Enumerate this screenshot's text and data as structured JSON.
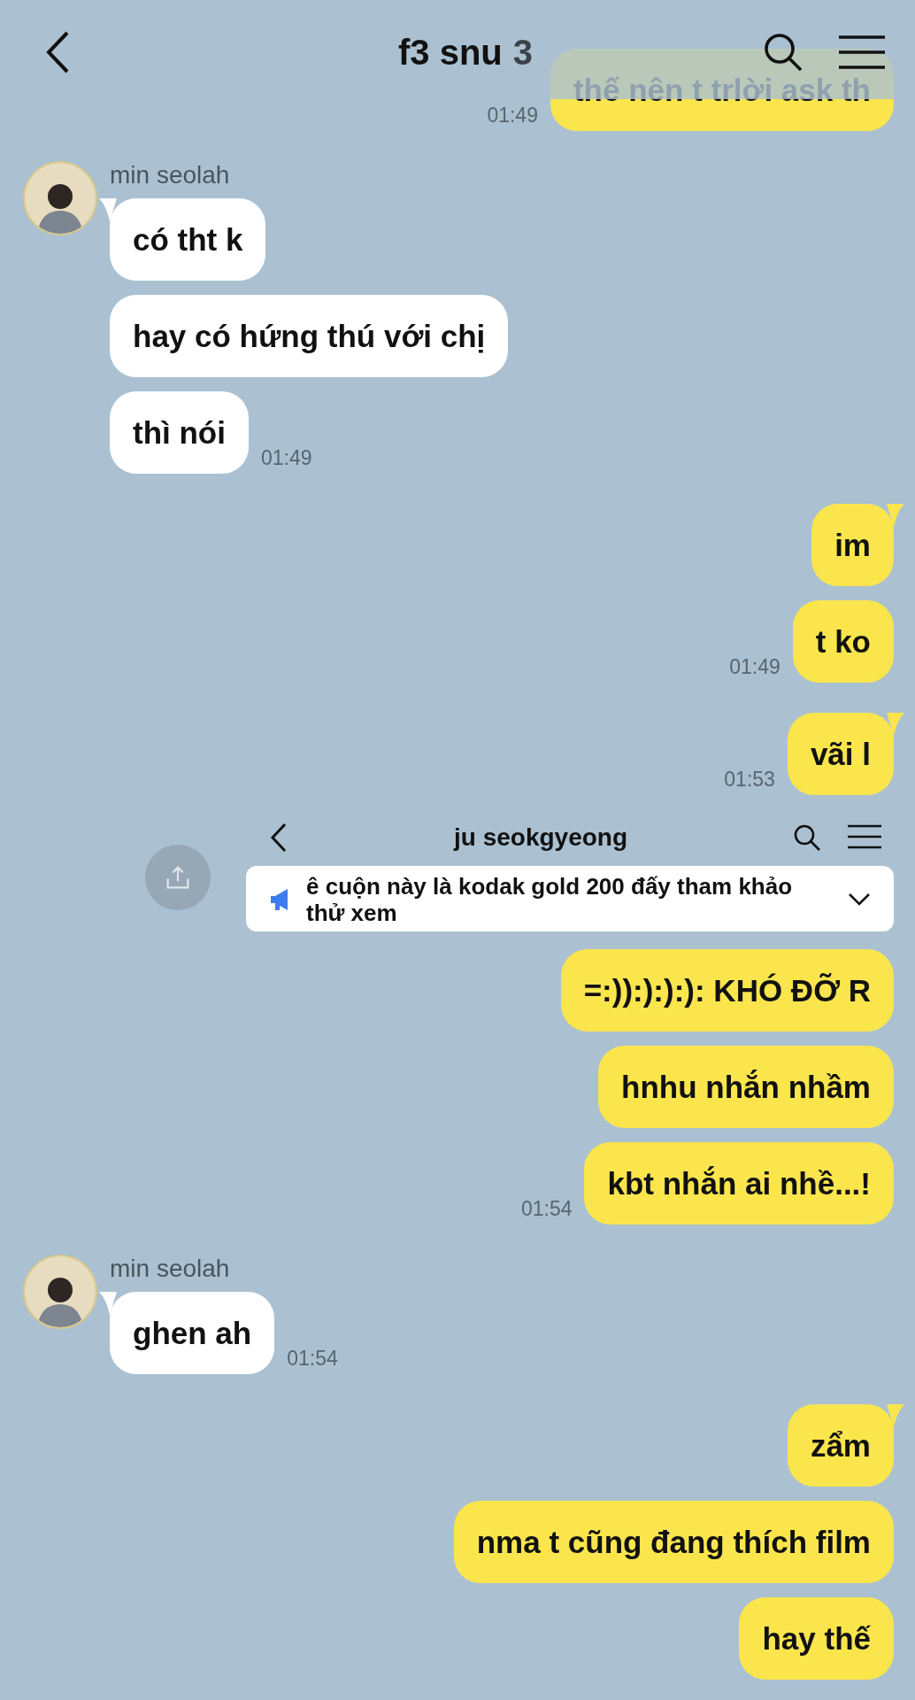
{
  "header": {
    "title": "f3 snu",
    "member_count": "3"
  },
  "groups": [
    {
      "kind": "outgoing",
      "tail": false,
      "messages": [
        "thế nên t trlời ask th"
      ],
      "time": "01:49"
    },
    {
      "kind": "incoming",
      "sender": "min seolah",
      "messages": [
        "có tht k",
        "hay có hứng thú với chị",
        "thì nói"
      ],
      "time": "01:49"
    },
    {
      "kind": "outgoing",
      "tail": true,
      "messages": [
        "im",
        "t ko"
      ],
      "time": "01:49"
    },
    {
      "kind": "outgoing",
      "tail": true,
      "messages": [
        "vãi l"
      ],
      "time": "01:53"
    },
    {
      "kind": "screenshot",
      "title": "ju seokgyeong",
      "notice": "ê cuộn này là kodak gold 200 đấy tham khảo thử xem"
    },
    {
      "kind": "outgoing",
      "tail": false,
      "messages": [
        "=:)):):):): KHÓ ĐỠ R",
        "hnhu nhắn nhầm",
        "kbt nhắn ai nhề...!"
      ],
      "time": "01:54"
    },
    {
      "kind": "incoming",
      "sender": "min seolah",
      "messages": [
        "ghen ah"
      ],
      "time": "01:54"
    },
    {
      "kind": "outgoing",
      "tail": true,
      "messages": [
        "zẩm",
        "nma t cũng đang thích film",
        "hay thế"
      ]
    }
  ]
}
